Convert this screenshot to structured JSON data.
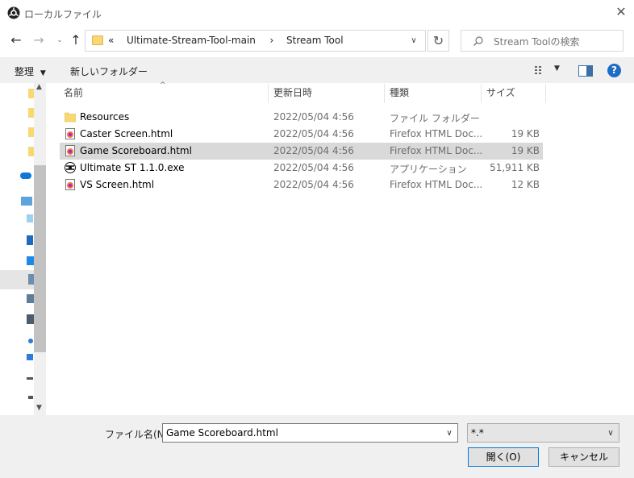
{
  "window": {
    "title": "ローカルファイル"
  },
  "address": {
    "prefix": "«",
    "segments": [
      "Ultimate-Stream-Tool-main",
      "Stream Tool"
    ],
    "separator": "›"
  },
  "search": {
    "placeholder": "Stream Toolの検索"
  },
  "commands": {
    "organize": "整理",
    "new_folder": "新しいフォルダー"
  },
  "columns": {
    "name": "名前",
    "date": "更新日時",
    "type": "種類",
    "size": "サイズ"
  },
  "files": [
    {
      "name": "Resources",
      "date": "2022/05/04 4:56",
      "type": "ファイル フォルダー",
      "size": "",
      "icon": "folder-icon"
    },
    {
      "name": "Caster Screen.html",
      "date": "2022/05/04 4:56",
      "type": "Firefox HTML Doc...",
      "size": "19 KB",
      "icon": "html-file-icon"
    },
    {
      "name": "Game Scoreboard.html",
      "date": "2022/05/04 4:56",
      "type": "Firefox HTML Doc...",
      "size": "19 KB",
      "icon": "html-file-icon",
      "selected": true
    },
    {
      "name": "Ultimate ST 1.1.0.exe",
      "date": "2022/05/04 4:56",
      "type": "アプリケーション",
      "size": "51,911 KB",
      "icon": "exe-icon"
    },
    {
      "name": "VS Screen.html",
      "date": "2022/05/04 4:56",
      "type": "Firefox HTML Doc...",
      "size": "12 KB",
      "icon": "html-file-icon"
    }
  ],
  "footer": {
    "filename_label": "ファイル名(N):",
    "filename_value": "Game Scoreboard.html",
    "filetype_value": "*.*",
    "open_label": "開く(O)",
    "cancel_label": "キャンセル"
  },
  "colors": {
    "accent": "#0078d7",
    "selected_row": "#d9d9d9",
    "folder": "#f8d775"
  }
}
